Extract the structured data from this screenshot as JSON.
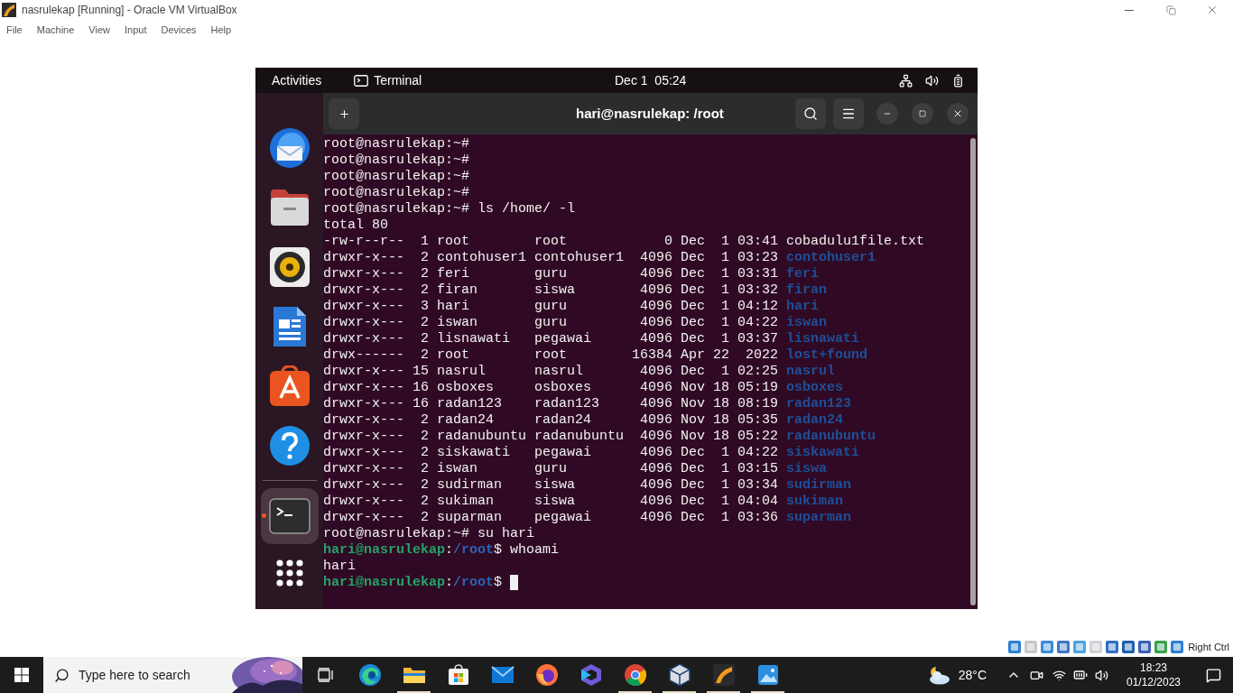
{
  "window": {
    "title": "nasrulekap [Running] - Oracle VM VirtualBox"
  },
  "menu": [
    "File",
    "Machine",
    "View",
    "Input",
    "Devices",
    "Help"
  ],
  "vm": {
    "top_bar": {
      "activities": "Activities",
      "app": "Terminal",
      "clock": "Dec 1  05:24"
    },
    "dock": {
      "favorites": [
        {
          "kind": "mail",
          "running": false
        },
        {
          "kind": "files",
          "running": false
        },
        {
          "kind": "music",
          "running": false
        },
        {
          "kind": "document",
          "running": false
        },
        {
          "kind": "store",
          "running": false
        },
        {
          "kind": "help",
          "running": false
        }
      ],
      "open_apps": [
        {
          "kind": "terminal",
          "running": true
        }
      ]
    },
    "terminal": {
      "title": "hari@nasrulekap: /root",
      "lines": [
        {
          "segments": [
            {
              "kind": "plain",
              "text": "root@nasrulekap:~#"
            }
          ]
        },
        {
          "segments": [
            {
              "kind": "plain",
              "text": "root@nasrulekap:~#"
            }
          ]
        },
        {
          "segments": [
            {
              "kind": "plain",
              "text": "root@nasrulekap:~#"
            }
          ]
        },
        {
          "segments": [
            {
              "kind": "plain",
              "text": "root@nasrulekap:~#"
            }
          ]
        },
        {
          "segments": [
            {
              "kind": "plain",
              "text": "root@nasrulekap:~# ls /home/ -l"
            }
          ]
        },
        {
          "segments": [
            {
              "kind": "plain",
              "text": "total 80"
            }
          ]
        },
        {
          "segments": [
            {
              "kind": "plain",
              "text": "-rw-r--r--  1 root        root            0 Dec  1 03:41 cobadulu1file.txt"
            }
          ]
        },
        {
          "segments": [
            {
              "kind": "plain",
              "text": "drwxr-x---  2 contohuser1 contohuser1  4096 Dec  1 03:23 "
            },
            {
              "kind": "dir",
              "text": "contohuser1"
            }
          ]
        },
        {
          "segments": [
            {
              "kind": "plain",
              "text": "drwxr-x---  2 feri        guru         4096 Dec  1 03:31 "
            },
            {
              "kind": "dir",
              "text": "feri"
            }
          ]
        },
        {
          "segments": [
            {
              "kind": "plain",
              "text": "drwxr-x---  2 firan       siswa        4096 Dec  1 03:32 "
            },
            {
              "kind": "dir",
              "text": "firan"
            }
          ]
        },
        {
          "segments": [
            {
              "kind": "plain",
              "text": "drwxr-x---  3 hari        guru         4096 Dec  1 04:12 "
            },
            {
              "kind": "dir",
              "text": "hari"
            }
          ]
        },
        {
          "segments": [
            {
              "kind": "plain",
              "text": "drwxr-x---  2 iswan       guru         4096 Dec  1 04:22 "
            },
            {
              "kind": "dir",
              "text": "iswan"
            }
          ]
        },
        {
          "segments": [
            {
              "kind": "plain",
              "text": "drwxr-x---  2 lisnawati   pegawai      4096 Dec  1 03:37 "
            },
            {
              "kind": "dir",
              "text": "lisnawati"
            }
          ]
        },
        {
          "segments": [
            {
              "kind": "plain",
              "text": "drwx------  2 root        root        16384 Apr 22  2022 "
            },
            {
              "kind": "dir",
              "text": "lost+found"
            }
          ]
        },
        {
          "segments": [
            {
              "kind": "plain",
              "text": "drwxr-x--- 15 nasrul      nasrul       4096 Dec  1 02:25 "
            },
            {
              "kind": "dir",
              "text": "nasrul"
            }
          ]
        },
        {
          "segments": [
            {
              "kind": "plain",
              "text": "drwxr-x--- 16 osboxes     osboxes      4096 Nov 18 05:19 "
            },
            {
              "kind": "dir",
              "text": "osboxes"
            }
          ]
        },
        {
          "segments": [
            {
              "kind": "plain",
              "text": "drwxr-x--- 16 radan123    radan123     4096 Nov 18 08:19 "
            },
            {
              "kind": "dir",
              "text": "radan123"
            }
          ]
        },
        {
          "segments": [
            {
              "kind": "plain",
              "text": "drwxr-x---  2 radan24     radan24      4096 Nov 18 05:35 "
            },
            {
              "kind": "dir",
              "text": "radan24"
            }
          ]
        },
        {
          "segments": [
            {
              "kind": "plain",
              "text": "drwxr-x---  2 radanubuntu radanubuntu  4096 Nov 18 05:22 "
            },
            {
              "kind": "dir",
              "text": "radanubuntu"
            }
          ]
        },
        {
          "segments": [
            {
              "kind": "plain",
              "text": "drwxr-x---  2 siskawati   pegawai      4096 Dec  1 04:22 "
            },
            {
              "kind": "dir",
              "text": "siskawati"
            }
          ]
        },
        {
          "segments": [
            {
              "kind": "plain",
              "text": "drwxr-x---  2 iswan       guru         4096 Dec  1 03:15 "
            },
            {
              "kind": "dir",
              "text": "siswa"
            }
          ]
        },
        {
          "segments": [
            {
              "kind": "plain",
              "text": "drwxr-x---  2 sudirman    siswa        4096 Dec  1 03:34 "
            },
            {
              "kind": "dir",
              "text": "sudirman"
            }
          ]
        },
        {
          "segments": [
            {
              "kind": "plain",
              "text": "drwxr-x---  2 sukiman     siswa        4096 Dec  1 04:04 "
            },
            {
              "kind": "dir",
              "text": "sukiman"
            }
          ]
        },
        {
          "segments": [
            {
              "kind": "plain",
              "text": "drwxr-x---  2 suparman    pegawai      4096 Dec  1 03:36 "
            },
            {
              "kind": "dir",
              "text": "suparman"
            }
          ]
        },
        {
          "segments": [
            {
              "kind": "plain",
              "text": "root@nasrulekap:~# su hari"
            }
          ]
        },
        {
          "segments": [
            {
              "kind": "user",
              "text": "hari@nasrulekap"
            },
            {
              "kind": "plain",
              "text": ":"
            },
            {
              "kind": "path",
              "text": "/root"
            },
            {
              "kind": "plain",
              "text": "$ whoami"
            }
          ]
        },
        {
          "segments": [
            {
              "kind": "plain",
              "text": "hari"
            }
          ]
        },
        {
          "segments": [
            {
              "kind": "user",
              "text": "hari@nasrulekap"
            },
            {
              "kind": "plain",
              "text": ":"
            },
            {
              "kind": "path",
              "text": "/root"
            },
            {
              "kind": "plain",
              "text": "$ "
            }
          ],
          "cursor": true
        }
      ]
    }
  },
  "host_key": "Right Ctrl",
  "taskbar": {
    "search": {
      "placeholder": "Type here to search"
    },
    "apps": [
      {
        "kind": "edge",
        "running": false
      },
      {
        "kind": "explorer",
        "running": true
      },
      {
        "kind": "store",
        "running": false
      },
      {
        "kind": "mail",
        "running": false
      },
      {
        "kind": "firefox",
        "running": false
      },
      {
        "kind": "copilot",
        "running": false
      },
      {
        "kind": "chrome",
        "running": true
      },
      {
        "kind": "virtualbox",
        "running": true
      },
      {
        "kind": "vm",
        "running": true
      },
      {
        "kind": "photos",
        "running": true
      }
    ],
    "weather": "28°C",
    "time": "18:23",
    "date": "01/12/2023"
  }
}
